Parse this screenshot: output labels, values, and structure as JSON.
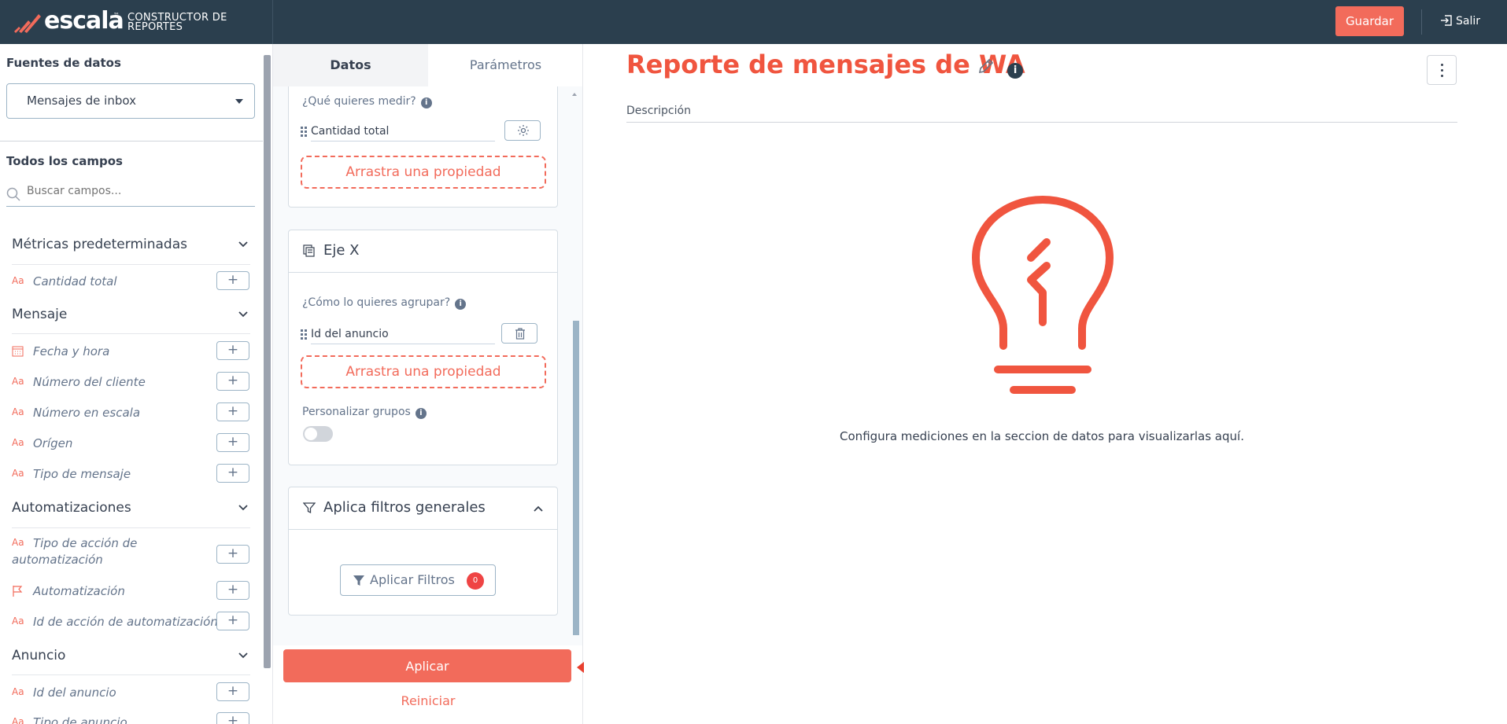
{
  "header": {
    "brand": "escala",
    "brand_tm": "™",
    "subtitle_line1": "CONSTRUCTOR DE",
    "subtitle_line2": "REPORTES",
    "save_label": "Guardar",
    "exit_label": "Salir"
  },
  "sidebar": {
    "sources_title": "Fuentes de datos",
    "source_selected": "Mensajes de inbox",
    "all_fields_title": "Todos los campos",
    "search_placeholder": "Buscar campos...",
    "groups": [
      {
        "label": "Métricas predeterminadas",
        "fields": [
          {
            "label": "Cantidad total",
            "icon": "text-type-icon"
          }
        ]
      },
      {
        "label": "Mensaje",
        "fields": [
          {
            "label": "Fecha y hora",
            "icon": "calendar-icon"
          },
          {
            "label": "Número del cliente",
            "icon": "text-type-icon"
          },
          {
            "label": "Número en escala",
            "icon": "text-type-icon"
          },
          {
            "label": "Orígen",
            "icon": "text-type-icon"
          },
          {
            "label": "Tipo de mensaje",
            "icon": "text-type-icon"
          }
        ]
      },
      {
        "label": "Automatizaciones",
        "fields": [
          {
            "label": "Tipo de acción de automatización",
            "icon": "text-type-icon"
          },
          {
            "label": "Automatización",
            "icon": "flag-icon"
          },
          {
            "label": "Id de acción de automatización",
            "icon": "text-type-icon"
          }
        ]
      },
      {
        "label": "Anuncio",
        "fields": [
          {
            "label": "Id del anuncio",
            "icon": "text-type-icon"
          },
          {
            "label": "Tipo de anuncio",
            "icon": "text-type-icon"
          }
        ]
      }
    ],
    "type_glyph": "Aa",
    "add_glyph": "+"
  },
  "panel": {
    "tabs": [
      {
        "label": "Datos",
        "active": true
      },
      {
        "label": "Parámetros",
        "active": false
      }
    ],
    "measure_question": "¿Qué quieres medir?",
    "measure_field": "Cantidad total",
    "drop_label": "Arrastra una propiedad",
    "xaxis_title": "Eje X",
    "group_question": "¿Cómo lo quieres agrupar?",
    "group_field": "Id del anuncio",
    "customize_groups": "Personalizar grupos",
    "filters_title": "Aplica filtros generales",
    "filters_button": "Aplicar Filtros",
    "filters_count": "0",
    "apply_label": "Aplicar",
    "reset_label": "Reiniciar",
    "info_glyph": "i"
  },
  "main": {
    "report_title": "Reporte de mensajes de WA",
    "description_label": "Descripción",
    "empty_message": "Configura mediciones en la seccion de datos para visualizarlas aquí.",
    "info_glyph": "i"
  },
  "colors": {
    "topbar": "#2b3f4e",
    "accent": "#f26b5b",
    "title": "#f0553f",
    "arrow": "#e8402f"
  }
}
